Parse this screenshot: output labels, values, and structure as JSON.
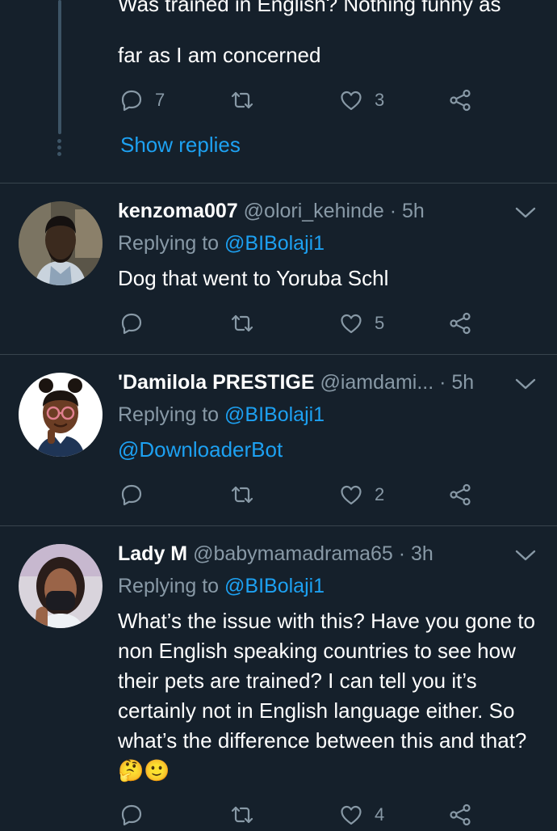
{
  "top_tweet": {
    "cut_line": "Was trained in English? Nothing funny as",
    "text_line2": "far as I am concerned",
    "replies": "7",
    "retweets": "",
    "likes": "3",
    "show_replies": "Show replies"
  },
  "tweets": [
    {
      "name": "kenzoma007",
      "handle": "@olori_kehinde",
      "sep": " · ",
      "time": "5h",
      "replying_prefix": "Replying to ",
      "replying_to": "@BIBolaji1",
      "body": "Dog that went to Yoruba Schl",
      "replies": "",
      "retweets": "",
      "likes": "5"
    },
    {
      "name": "'Damilola PRESTIGE",
      "handle": "@iamdami...",
      "sep": " · ",
      "time": "5h",
      "replying_prefix": "Replying to ",
      "replying_to": "@BIBolaji1",
      "body": "@DownloaderBot",
      "replies": "",
      "retweets": "",
      "likes": "2"
    },
    {
      "name": "Lady M",
      "handle": "@babymamadrama65",
      "sep": " · ",
      "time": "3h",
      "replying_prefix": "Replying to ",
      "replying_to": "@BIBolaji1",
      "body": "What’s the issue with this? Have you gone to non English speaking countries to see how their pets are trained? I can tell you it’s certainly not in English language either. So what’s the difference between this and that? 🤔🙂",
      "replies": "",
      "retweets": "",
      "likes": "4"
    }
  ],
  "icons": {
    "reply": "reply-icon",
    "retweet": "retweet-icon",
    "like": "heart-icon",
    "share": "share-icon",
    "more": "chevron-down-icon"
  },
  "colors": {
    "background": "#15202b",
    "accent": "#1da1f2",
    "muted": "#8899a6",
    "divider": "#38444d"
  }
}
